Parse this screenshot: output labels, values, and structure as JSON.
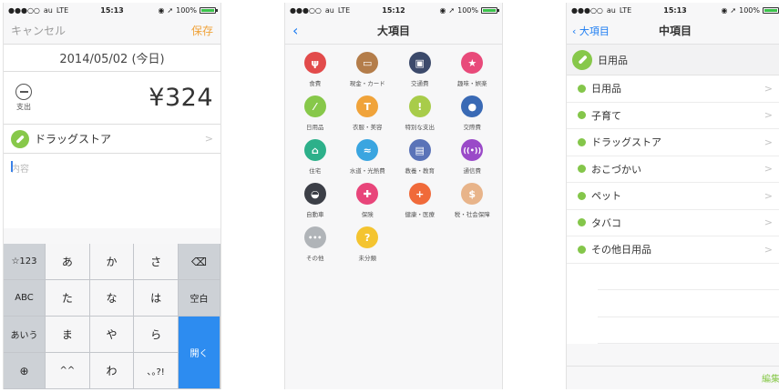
{
  "status": {
    "carrier": "au",
    "network": "LTE",
    "battery": "100%",
    "times": [
      "15:13",
      "15:12",
      "15:13"
    ],
    "signal": "●●●○○"
  },
  "screen1": {
    "cancel_label": "キャンセル",
    "save_label": "保存",
    "date": "2014/05/02 (今日)",
    "expense_label": "支出",
    "amount": "¥324",
    "category": "ドラッグストア",
    "memo_placeholder": "内容",
    "keyboard": {
      "rows": [
        [
          "☆123",
          "あ",
          "か",
          "さ",
          "⌫"
        ],
        [
          "ABC",
          "た",
          "な",
          "は",
          "空白"
        ],
        [
          "あいう",
          "ま",
          "や",
          "ら"
        ],
        [
          "⊕",
          "^^",
          "わ",
          "､｡?!"
        ]
      ],
      "enter_label": "開く"
    }
  },
  "screen2": {
    "title": "大項目",
    "categories": [
      {
        "label": "食費",
        "color": "#e24b4b",
        "glyph": "ψ",
        "icon": "fork-knife-icon"
      },
      {
        "label": "現金・カード",
        "color": "#b47d4a",
        "glyph": "▭",
        "icon": "card-icon"
      },
      {
        "label": "交通費",
        "color": "#3c4a6b",
        "glyph": "▣",
        "icon": "train-icon"
      },
      {
        "label": "趣味・娯楽",
        "color": "#e84a7a",
        "glyph": "★",
        "icon": "star-icon"
      },
      {
        "label": "日用品",
        "color": "#87c84a",
        "glyph": "⁄",
        "icon": "pill-icon"
      },
      {
        "label": "衣服・美容",
        "color": "#f0a33a",
        "glyph": "T",
        "icon": "shirt-icon"
      },
      {
        "label": "特別な支出",
        "color": "#a8cc4a",
        "glyph": "!",
        "icon": "exclamation-icon"
      },
      {
        "label": "交際費",
        "color": "#3a6ab5",
        "glyph": "●",
        "icon": "people-icon"
      },
      {
        "label": "住宅",
        "color": "#2db08a",
        "glyph": "⌂",
        "icon": "house-icon"
      },
      {
        "label": "水道・光熱費",
        "color": "#3aa5e0",
        "glyph": "≈",
        "icon": "faucet-icon"
      },
      {
        "label": "教養・教育",
        "color": "#5a73b8",
        "glyph": "▤",
        "icon": "book-icon"
      },
      {
        "label": "通信費",
        "color": "#9a4ac8",
        "glyph": "((•))",
        "icon": "signal-icon"
      },
      {
        "label": "自動車",
        "color": "#3c3f47",
        "glyph": "◒",
        "icon": "car-icon"
      },
      {
        "label": "保険",
        "color": "#e8457a",
        "glyph": "✚",
        "icon": "insurance-bag-icon"
      },
      {
        "label": "健康・医療",
        "color": "#f06a3a",
        "glyph": "+",
        "icon": "cross-icon"
      },
      {
        "label": "税・社会保障",
        "color": "#e8b48a",
        "glyph": "$",
        "icon": "coins-icon"
      },
      {
        "label": "その他",
        "color": "#b0b4b8",
        "glyph": "•••",
        "icon": "more-icon"
      },
      {
        "label": "未分類",
        "color": "#f4c430",
        "glyph": "?",
        "icon": "question-icon"
      }
    ]
  },
  "screen3": {
    "back_label": "大項目",
    "title": "中項目",
    "parent_category": "日用品",
    "subcategories": [
      "日用品",
      "子育て",
      "ドラッグストア",
      "おこづかい",
      "ペット",
      "タバコ",
      "その他日用品"
    ],
    "edit_label": "編集"
  },
  "colors": {
    "accent_orange": "#f0a33a",
    "ios_blue": "#1b7cf2",
    "category_green": "#87c84a",
    "keyboard_enter": "#2d8cf0"
  }
}
